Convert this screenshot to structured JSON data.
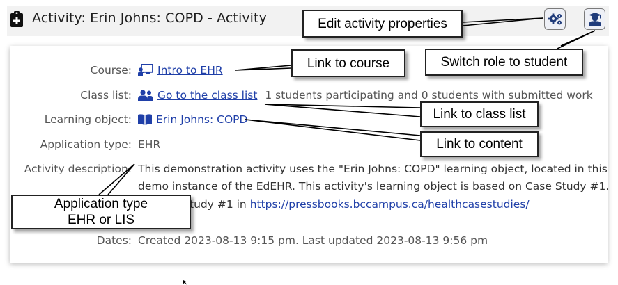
{
  "header": {
    "title": "Activity: Erin Johns: COPD - Activity"
  },
  "details": {
    "course_label": "Course:",
    "course_link": "Intro to EHR",
    "classlist_label": "Class list:",
    "classlist_link": "Go to the class list",
    "classlist_info": "1 students participating and 0 students with submitted work",
    "lobj_label": "Learning object:",
    "lobj_link": "Erin Johns: COPD",
    "apptype_label": "Application type:",
    "apptype_value": "EHR",
    "desc_label": "Activity description:",
    "desc_line1": "This demonstration activity uses the \"Erin Johns: COPD\" learning object, located in this",
    "desc_line2": "demo instance of the EdEHR. This activity's learning object is based on Case Study #1.",
    "desc_line3_text": "tudy #1 in",
    "desc_line3_link": "https://pressbooks.bccampus.ca/healthcasestudies/",
    "dates_label": "Dates:",
    "dates_value": "Created 2023-08-13 9:15 pm. Last updated 2023-08-13 9:56 pm"
  },
  "callouts": {
    "edit_properties": "Edit activity properties",
    "link_course": "Link to course",
    "switch_role": "Switch role to student",
    "link_classlist": "Link to class list",
    "link_content": "Link to content",
    "apptype_line1": "Application type",
    "apptype_line2": "EHR or LIS"
  }
}
